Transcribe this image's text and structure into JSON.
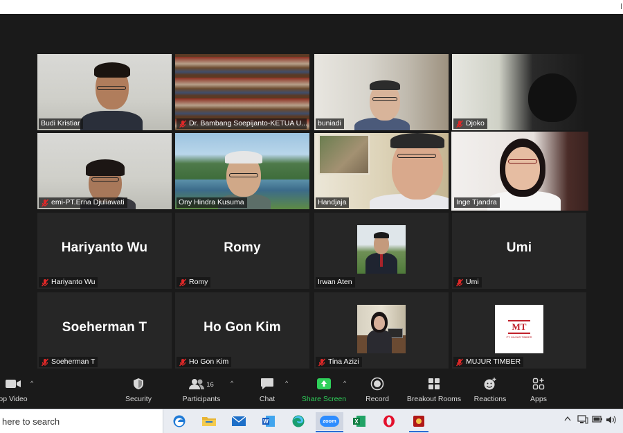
{
  "tiles": [
    {
      "name": "Budi Kristiar",
      "muted": false,
      "video": true
    },
    {
      "name": "Dr. Bambang Soepijanto-KETUA U...",
      "muted": true,
      "video": true
    },
    {
      "name": "buniadi",
      "muted": false,
      "video": true
    },
    {
      "name": "Djoko",
      "muted": true,
      "video": true
    },
    {
      "name": "emi-PT.Erna Djuliawati",
      "muted": true,
      "video": true
    },
    {
      "name": "Ony Hindra Kusuma",
      "muted": false,
      "video": true
    },
    {
      "name": "Handjaja",
      "muted": false,
      "video": true
    },
    {
      "name": "Inge Tjandra",
      "muted": false,
      "video": true,
      "active_speaker": true
    },
    {
      "name": "Hariyanto Wu",
      "muted": true,
      "video": false,
      "display_name": "Hariyanto Wu"
    },
    {
      "name": "Romy",
      "muted": true,
      "video": false,
      "display_name": "Romy"
    },
    {
      "name": "Irwan Aten",
      "muted": false,
      "video": false,
      "profile_picture": true
    },
    {
      "name": "Umi",
      "muted": true,
      "video": false,
      "display_name": "Umi"
    },
    {
      "name": "Soeherman T",
      "muted": true,
      "video": false,
      "display_name": "Soeherman T"
    },
    {
      "name": "Ho Gon Kim",
      "muted": true,
      "video": false,
      "display_name": "Ho Gon Kim"
    },
    {
      "name": "Tina Azizi",
      "muted": true,
      "video": false,
      "profile_picture": true
    },
    {
      "name": "MUJUR TIMBER",
      "muted": true,
      "video": false,
      "profile_picture": true,
      "logo_text": "MT",
      "logo_subtext": "PT. MUJUR TIMBER"
    }
  ],
  "toolbar": {
    "stop_video": "op Video",
    "security": "Security",
    "participants": "Participants",
    "participants_count": "16",
    "chat": "Chat",
    "share_screen": "Share Screen",
    "record": "Record",
    "breakout_rooms": "Breakout Rooms",
    "reactions": "Reactions",
    "apps": "Apps"
  },
  "taskbar": {
    "search_placeholder": "here to search",
    "apps": [
      "edge-legacy-icon",
      "file-explorer-icon",
      "mail-icon",
      "word-icon",
      "edge-icon",
      "zoom-icon",
      "excel-icon",
      "opera-icon",
      "game-icon"
    ],
    "zoom_label": "zoom"
  },
  "colors": {
    "meeting_bg": "#1a1a1a",
    "tile_bg": "#262626",
    "active_outline": "#c9e06a",
    "mute_red": "#e02828",
    "share_green": "#2fd05a"
  }
}
